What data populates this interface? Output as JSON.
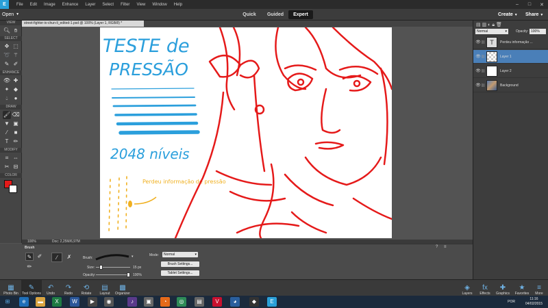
{
  "menu": {
    "logo": "E",
    "items": [
      "File",
      "Edit",
      "Image",
      "Enhance",
      "Layer",
      "Select",
      "Filter",
      "View",
      "Window",
      "Help"
    ]
  },
  "modebar": {
    "open": "Open",
    "tabs": [
      "Quick",
      "Guided",
      "Expert"
    ],
    "active_tab": "Expert",
    "create": "Create",
    "share": "Share"
  },
  "toolbox": {
    "sections": [
      "VIEW",
      "SELECT",
      "ENHANCE",
      "DRAW",
      "MODIFY",
      "COLOR"
    ]
  },
  "document": {
    "tab_title": "street-fighter-iv-chun-li_edited-1.psd @ 100% (Layer 1, RGB/8) *",
    "zoom": "100%",
    "doc_size": "Doc: 2,25M/6,97M"
  },
  "artwork": {
    "title_line1": "TESTE de",
    "title_line2": "PRESSÃO",
    "levels": "2048 níveis",
    "note": "Perdeu informação de pressão",
    "blue": "#2b9fdc",
    "red": "#e51a1a",
    "orange": "#f0b020"
  },
  "layers_panel": {
    "blend_mode": "Normal",
    "opacity_label": "Opacity:",
    "opacity_value": "100%",
    "layers": [
      {
        "name": "Perdeu informação ...",
        "type": "text",
        "selected": false
      },
      {
        "name": "Layer 1",
        "type": "transparent",
        "selected": true
      },
      {
        "name": "Layer 2",
        "type": "white",
        "selected": false
      },
      {
        "name": "Background",
        "type": "photo",
        "selected": false
      }
    ]
  },
  "tool_options": {
    "tool_name": "Brush",
    "brush_label": "Brush:",
    "size_label": "Size:",
    "size_value": "15 px",
    "size_fraction": 0.1,
    "opacity_label": "Opacity:",
    "opacity_value": "100%",
    "opacity_fraction": 1.0,
    "mode_label": "Mode:",
    "mode_value": "Normal",
    "brush_settings": "Brush Settings...",
    "tablet_settings": "Tablet Settings..."
  },
  "bottom_bar": {
    "left": [
      "Photo Bin",
      "Tool Options",
      "Undo",
      "Redo",
      "Rotate",
      "Layout",
      "Organizer"
    ],
    "right": [
      "Layers",
      "Effects",
      "Graphics",
      "Favorites",
      "More"
    ]
  },
  "system": {
    "lang": "POR",
    "time": "11:16",
    "date": "04/02/2015"
  }
}
